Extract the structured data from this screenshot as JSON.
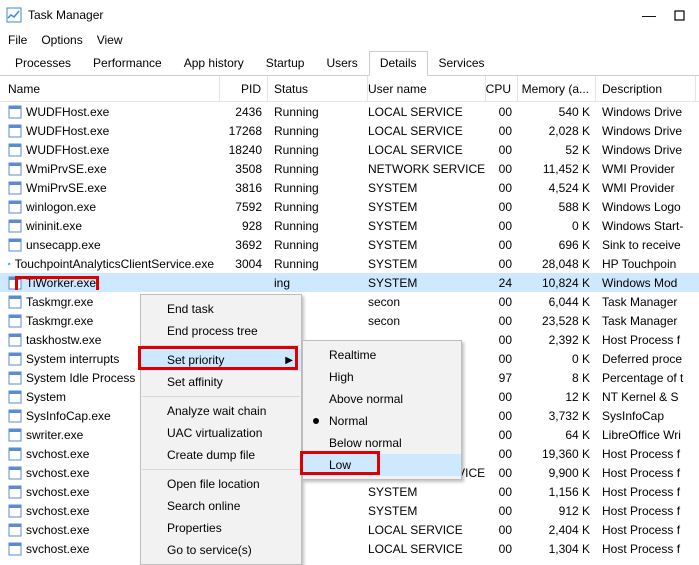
{
  "window": {
    "title": "Task Manager"
  },
  "menubar": [
    "File",
    "Options",
    "View"
  ],
  "tabs": [
    "Processes",
    "Performance",
    "App history",
    "Startup",
    "Users",
    "Details",
    "Services"
  ],
  "activeTab": "Details",
  "columns": [
    "Name",
    "PID",
    "Status",
    "User name",
    "CPU",
    "Memory (a...",
    "Description"
  ],
  "rows": [
    {
      "name": "WUDFHost.exe",
      "pid": "2436",
      "status": "Running",
      "user": "LOCAL SERVICE",
      "cpu": "00",
      "mem": "540 K",
      "desc": "Windows Drive"
    },
    {
      "name": "WUDFHost.exe",
      "pid": "17268",
      "status": "Running",
      "user": "LOCAL SERVICE",
      "cpu": "00",
      "mem": "2,028 K",
      "desc": "Windows Drive"
    },
    {
      "name": "WUDFHost.exe",
      "pid": "18240",
      "status": "Running",
      "user": "LOCAL SERVICE",
      "cpu": "00",
      "mem": "52 K",
      "desc": "Windows Drive"
    },
    {
      "name": "WmiPrvSE.exe",
      "pid": "3508",
      "status": "Running",
      "user": "NETWORK SERVICE",
      "cpu": "00",
      "mem": "11,452 K",
      "desc": "WMI Provider "
    },
    {
      "name": "WmiPrvSE.exe",
      "pid": "3816",
      "status": "Running",
      "user": "SYSTEM",
      "cpu": "00",
      "mem": "4,524 K",
      "desc": "WMI Provider "
    },
    {
      "name": "winlogon.exe",
      "pid": "7592",
      "status": "Running",
      "user": "SYSTEM",
      "cpu": "00",
      "mem": "588 K",
      "desc": "Windows Logo"
    },
    {
      "name": "wininit.exe",
      "pid": "928",
      "status": "Running",
      "user": "SYSTEM",
      "cpu": "00",
      "mem": "0 K",
      "desc": "Windows Start-"
    },
    {
      "name": "unsecapp.exe",
      "pid": "3692",
      "status": "Running",
      "user": "SYSTEM",
      "cpu": "00",
      "mem": "696 K",
      "desc": "Sink to receive"
    },
    {
      "name": "TouchpointAnalyticsClientService.exe",
      "pid": "3004",
      "status": "Running",
      "user": "SYSTEM",
      "cpu": "00",
      "mem": "28,048 K",
      "desc": "HP Touchpoin"
    },
    {
      "name": "TiWorker.exe",
      "pid": "",
      "status": "ing",
      "user": "SYSTEM",
      "cpu": "24",
      "mem": "10,824 K",
      "desc": "Windows Mod",
      "selected": true,
      "hp": false,
      "redbox": true
    },
    {
      "name": "Taskmgr.exe",
      "pid": "",
      "status": "ing",
      "user": "secon",
      "cpu": "00",
      "mem": "6,044 K",
      "desc": "Task Manager"
    },
    {
      "name": "Taskmgr.exe",
      "pid": "",
      "status": "ing",
      "user": "secon",
      "cpu": "00",
      "mem": "23,528 K",
      "desc": "Task Manager"
    },
    {
      "name": "taskhostw.exe",
      "pid": "",
      "status": "",
      "user": "",
      "cpu": "00",
      "mem": "2,392 K",
      "desc": "Host Process f"
    },
    {
      "name": "System interrupts",
      "pid": "",
      "status": "",
      "user": "",
      "cpu": "00",
      "mem": "0 K",
      "desc": "Deferred proce"
    },
    {
      "name": "System Idle Process",
      "pid": "",
      "status": "",
      "user": "",
      "cpu": "97",
      "mem": "8 K",
      "desc": "Percentage of t"
    },
    {
      "name": "System",
      "pid": "",
      "status": "",
      "user": "",
      "cpu": "00",
      "mem": "12 K",
      "desc": "NT Kernel & S"
    },
    {
      "name": "SysInfoCap.exe",
      "pid": "",
      "status": "",
      "user": "",
      "cpu": "00",
      "mem": "3,732 K",
      "desc": "SysInfoCap"
    },
    {
      "name": "swriter.exe",
      "pid": "",
      "status": "",
      "user": "",
      "cpu": "00",
      "mem": "64 K",
      "desc": "LibreOffice Wri"
    },
    {
      "name": "svchost.exe",
      "pid": "",
      "status": "",
      "user": "",
      "cpu": "00",
      "mem": "19,360 K",
      "desc": "Host Process f"
    },
    {
      "name": "svchost.exe",
      "pid": "",
      "status": "ing",
      "user": "NETWORK SERVICE",
      "cpu": "00",
      "mem": "9,900 K",
      "desc": "Host Process f"
    },
    {
      "name": "svchost.exe",
      "pid": "",
      "status": "ing",
      "user": "SYSTEM",
      "cpu": "00",
      "mem": "1,156 K",
      "desc": "Host Process f"
    },
    {
      "name": "svchost.exe",
      "pid": "",
      "status": "ing",
      "user": "SYSTEM",
      "cpu": "00",
      "mem": "912 K",
      "desc": "Host Process f"
    },
    {
      "name": "svchost.exe",
      "pid": "",
      "status": "ing",
      "user": "LOCAL SERVICE",
      "cpu": "00",
      "mem": "2,404 K",
      "desc": "Host Process f"
    },
    {
      "name": "svchost.exe",
      "pid": "",
      "status": "ing",
      "user": "LOCAL SERVICE",
      "cpu": "00",
      "mem": "1,304 K",
      "desc": "Host Process f"
    }
  ],
  "context1": {
    "items": [
      {
        "label": "End task"
      },
      {
        "label": "End process tree"
      },
      {
        "sep": true
      },
      {
        "label": "Set priority",
        "submenu": true,
        "highlight": true,
        "redbox": true
      },
      {
        "label": "Set affinity"
      },
      {
        "sep": true
      },
      {
        "label": "Analyze wait chain"
      },
      {
        "label": "UAC virtualization",
        "disabled": true
      },
      {
        "label": "Create dump file"
      },
      {
        "sep": true
      },
      {
        "label": "Open file location"
      },
      {
        "label": "Search online"
      },
      {
        "label": "Properties"
      },
      {
        "label": "Go to service(s)"
      }
    ]
  },
  "context2": {
    "items": [
      {
        "label": "Realtime"
      },
      {
        "label": "High"
      },
      {
        "label": "Above normal"
      },
      {
        "label": "Normal",
        "checked": true
      },
      {
        "label": "Below normal"
      },
      {
        "label": "Low",
        "highlight": true,
        "redbox": true
      }
    ]
  }
}
